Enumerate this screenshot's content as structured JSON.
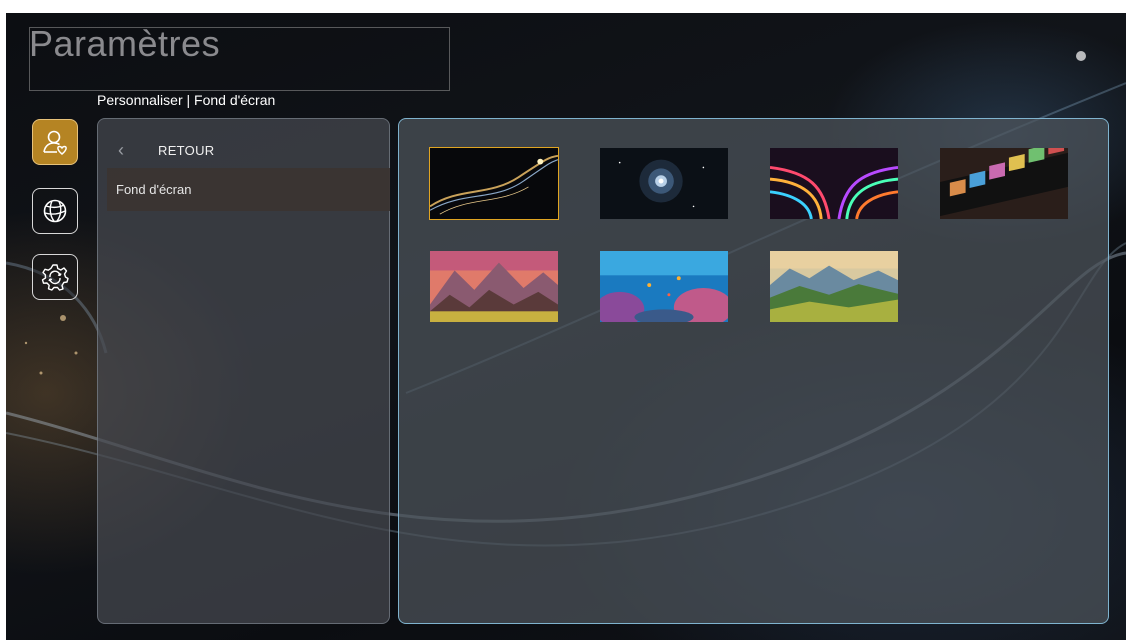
{
  "header": {
    "title": "Paramètres",
    "breadcrumb": "Personnaliser | Fond d'écran"
  },
  "sidebar": {
    "items": [
      {
        "icon": "user-heart-icon",
        "active": true
      },
      {
        "icon": "globe-icon",
        "active": false
      },
      {
        "icon": "gear-icon",
        "active": false
      }
    ]
  },
  "menu": {
    "back_label": "RETOUR",
    "items": [
      {
        "label": "Fond d'écran",
        "active": true
      }
    ]
  },
  "gallery": {
    "selected_index": 0,
    "wallpapers": [
      {
        "name": "dark-gold-waves"
      },
      {
        "name": "space-nebula"
      },
      {
        "name": "colorful-light-streaks"
      },
      {
        "name": "film-strip"
      },
      {
        "name": "mountain-sunset"
      },
      {
        "name": "coral-reef"
      },
      {
        "name": "green-valley"
      }
    ]
  },
  "colors": {
    "accent": "#b58423",
    "selection_border": "#e0a522",
    "panel_border": "#8cc8e6"
  }
}
